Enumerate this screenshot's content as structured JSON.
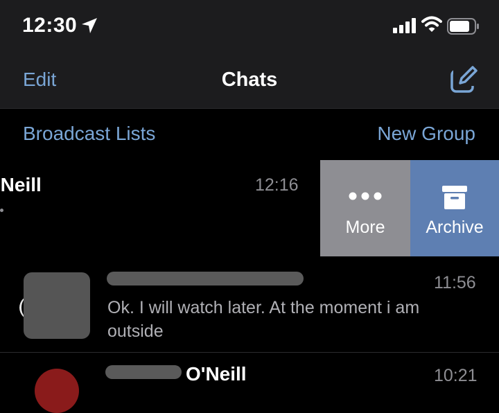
{
  "status": {
    "time": "12:30",
    "icons": [
      "location-arrow-icon",
      "signal-bars-icon",
      "wifi-icon",
      "battery-icon"
    ]
  },
  "nav": {
    "edit_label": "Edit",
    "title": "Chats",
    "compose_icon": "compose-icon"
  },
  "links": {
    "broadcast_label": "Broadcast Lists",
    "new_group_label": "New Group"
  },
  "swiped_chat": {
    "name": "'Neill",
    "time": "12:16",
    "actions": [
      {
        "label": "More",
        "icon": "ellipsis-icon"
      },
      {
        "label": "Archive",
        "icon": "archive-box-icon"
      }
    ]
  },
  "chats": [
    {
      "time": "11:56",
      "preview": "Ok. I will watch later. At the moment i am outside"
    },
    {
      "name_suffix": "O'Neill",
      "time": "10:21"
    }
  ],
  "colors": {
    "accent": "#7aa6d6",
    "more_bg": "#8e8e93",
    "archive_bg": "#5e7fb2",
    "bar_bg": "#1c1c1e"
  }
}
